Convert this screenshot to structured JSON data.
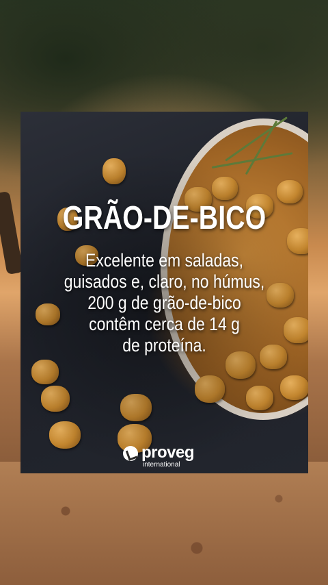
{
  "card": {
    "title": "GRÃO-DE-BICO",
    "body_lines": [
      "Excelente em saladas,",
      "guisados e, claro, no húmus,",
      "200 g de grão-de-bico",
      "contêm cerca de 14 g",
      "de proteína."
    ]
  },
  "logo": {
    "name": "proveg",
    "subtitle": "international"
  }
}
